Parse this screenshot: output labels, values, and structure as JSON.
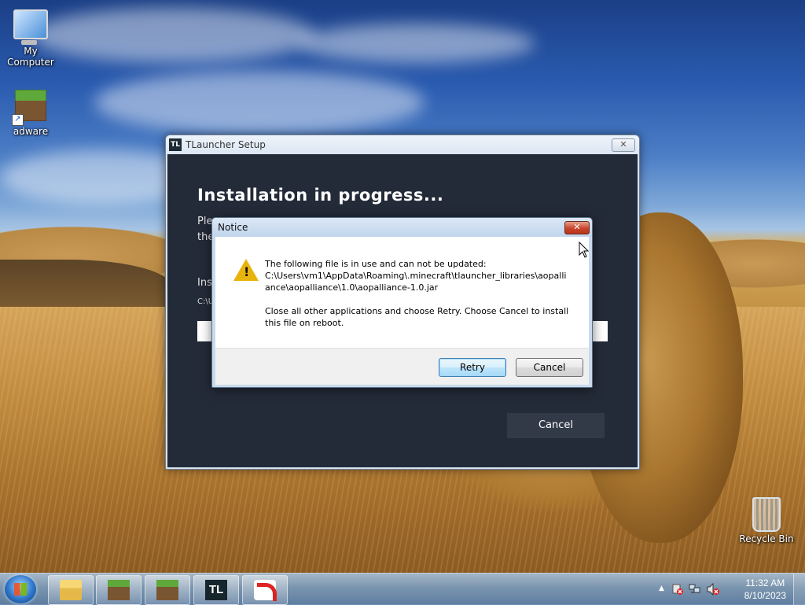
{
  "desktop": {
    "icons": [
      {
        "label": "My Computer",
        "icon": "computer-icon"
      },
      {
        "label": "adware",
        "icon": "minecraft-block-icon"
      },
      {
        "label": "Recycle Bin",
        "icon": "recycle-bin-icon"
      }
    ]
  },
  "tlauncher": {
    "title": "TLauncher Setup",
    "close_glyph": "✕",
    "heading": "Installation in progress...",
    "line1": "Ple",
    "line2": "the",
    "line3": "Ins",
    "path_partial": "C:\\U",
    "cancel_label": "Cancel"
  },
  "notice": {
    "title": "Notice",
    "close_glyph": "✕",
    "icon": "warning-icon",
    "message_lines": [
      "The following file is in use and can not be updated:",
      "C:\\Users\\vm1\\AppData\\Roaming\\.minecraft\\tlauncher_libraries\\aopalli",
      "ance\\aopalliance\\1.0\\aopalliance-1.0.jar"
    ],
    "instruction_lines": [
      "Close all other applications and choose Retry.  Choose Cancel to install",
      "this file on reboot."
    ],
    "retry_label": "Retry",
    "cancel_label": "Cancel"
  },
  "taskbar": {
    "items": [
      {
        "name": "windows-explorer",
        "icon": "folder-icon"
      },
      {
        "name": "minecraft-1",
        "icon": "minecraft-block-icon"
      },
      {
        "name": "minecraft-2",
        "icon": "minecraft-block-icon"
      },
      {
        "name": "tlauncher",
        "icon": "tlauncher-icon",
        "text": "TL"
      },
      {
        "name": "red-app",
        "icon": "red-arc-icon"
      }
    ],
    "tray": {
      "show_hidden_glyph": "▲",
      "time": "11:32 AM",
      "date": "8/10/2023"
    }
  }
}
